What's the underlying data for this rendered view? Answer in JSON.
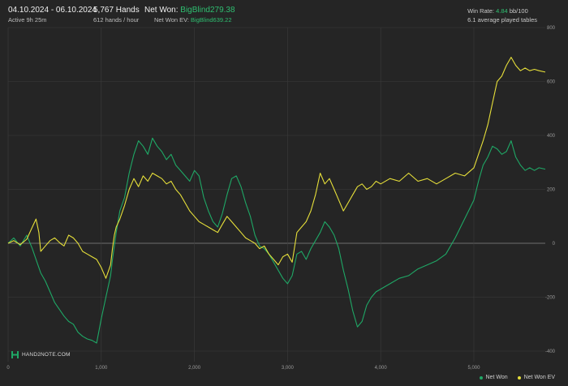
{
  "header": {
    "date_range": "04.10.2024 - 06.10.2024",
    "active": "Active 9h 25m",
    "hands": "5,767 Hands",
    "hands_rate": "612 hands / hour",
    "net_won_label": "Net Won:",
    "net_won_value": "BigBlind279.38",
    "net_won_ev_label": "Net Won  EV:",
    "net_won_ev_value": "BigBlind639.22",
    "win_rate_label": "Win Rate:",
    "win_rate_value": "4.84",
    "win_rate_unit": "bb/100",
    "avg_tables": "6.1 average played tables"
  },
  "logo": {
    "text": "HAND2NOTE.COM"
  },
  "legend": {
    "net_won": "Net Won",
    "net_won_ev": "Net Won  EV"
  },
  "colors": {
    "background": "#252525",
    "grid": "#3c3c3c",
    "zero_line": "#8a8a8a",
    "net_won": "#1fa866",
    "net_won_ev": "#e6df3a",
    "accent": "#2fbf71"
  },
  "chart_data": {
    "type": "line",
    "xlim": [
      0,
      5767
    ],
    "ylim": [
      -400,
      800
    ],
    "x_ticks": [
      0,
      1000,
      2000,
      3000,
      4000,
      5000
    ],
    "x_tick_labels": [
      "0",
      "1,000",
      "2,000",
      "3,000",
      "4,000",
      "5,000"
    ],
    "y_ticks": [
      -400,
      -200,
      0,
      200,
      400,
      600,
      800
    ],
    "y_tick_labels": [
      "-400",
      "-200",
      "0",
      "200",
      "400",
      "600",
      "800"
    ],
    "series": [
      {
        "name": "Net Won",
        "color": "#1fa866",
        "x": [
          0,
          60,
          130,
          200,
          260,
          300,
          330,
          350,
          400,
          450,
          500,
          560,
          600,
          650,
          700,
          750,
          800,
          850,
          900,
          950,
          1000,
          1050,
          1100,
          1120,
          1140,
          1160,
          1200,
          1250,
          1300,
          1350,
          1400,
          1450,
          1500,
          1550,
          1600,
          1650,
          1700,
          1750,
          1800,
          1850,
          1900,
          1950,
          2000,
          2050,
          2100,
          2150,
          2200,
          2250,
          2300,
          2350,
          2400,
          2450,
          2500,
          2550,
          2600,
          2650,
          2700,
          2750,
          2800,
          2850,
          2900,
          2950,
          3000,
          3050,
          3100,
          3150,
          3200,
          3250,
          3300,
          3350,
          3400,
          3450,
          3500,
          3550,
          3600,
          3650,
          3700,
          3750,
          3800,
          3850,
          3900,
          3950,
          4000,
          4100,
          4200,
          4300,
          4400,
          4500,
          4600,
          4700,
          4800,
          4900,
          5000,
          5050,
          5100,
          5150,
          5200,
          5250,
          5300,
          5350,
          5400,
          5450,
          5500,
          5550,
          5600,
          5650,
          5700,
          5767
        ],
        "values": [
          0,
          20,
          -10,
          30,
          -20,
          -60,
          -90,
          -110,
          -140,
          -180,
          -220,
          -250,
          -270,
          -290,
          -300,
          -330,
          -345,
          -355,
          -360,
          -370,
          -280,
          -200,
          -120,
          -60,
          -10,
          40,
          120,
          170,
          260,
          330,
          380,
          360,
          330,
          390,
          360,
          340,
          310,
          330,
          290,
          270,
          250,
          230,
          270,
          250,
          170,
          120,
          80,
          60,
          110,
          180,
          240,
          250,
          210,
          150,
          100,
          30,
          -10,
          -20,
          -40,
          -70,
          -100,
          -130,
          -150,
          -120,
          -40,
          -30,
          -60,
          -20,
          10,
          40,
          80,
          60,
          30,
          -20,
          -100,
          -170,
          -250,
          -310,
          -290,
          -230,
          -200,
          -180,
          -170,
          -150,
          -130,
          -120,
          -95,
          -80,
          -65,
          -40,
          20,
          90,
          160,
          230,
          290,
          320,
          360,
          350,
          330,
          340,
          380,
          320,
          290,
          270,
          280,
          270,
          280,
          275
        ]
      },
      {
        "name": "Net Won  EV",
        "color": "#e6df3a",
        "x": [
          0,
          60,
          130,
          200,
          260,
          300,
          330,
          350,
          400,
          450,
          500,
          560,
          600,
          650,
          700,
          750,
          800,
          850,
          900,
          950,
          1000,
          1050,
          1100,
          1120,
          1140,
          1160,
          1200,
          1250,
          1300,
          1350,
          1400,
          1450,
          1500,
          1550,
          1600,
          1650,
          1700,
          1750,
          1800,
          1850,
          1900,
          1950,
          2000,
          2050,
          2100,
          2150,
          2200,
          2250,
          2300,
          2350,
          2400,
          2450,
          2500,
          2550,
          2600,
          2650,
          2700,
          2750,
          2800,
          2850,
          2900,
          2950,
          3000,
          3050,
          3100,
          3150,
          3200,
          3250,
          3300,
          3350,
          3400,
          3450,
          3500,
          3550,
          3600,
          3650,
          3700,
          3750,
          3800,
          3850,
          3900,
          3950,
          4000,
          4100,
          4200,
          4300,
          4400,
          4500,
          4600,
          4700,
          4800,
          4900,
          5000,
          5050,
          5100,
          5150,
          5200,
          5250,
          5300,
          5350,
          5400,
          5450,
          5500,
          5550,
          5600,
          5650,
          5700,
          5767
        ],
        "values": [
          0,
          10,
          -5,
          15,
          60,
          90,
          40,
          -30,
          -10,
          10,
          20,
          0,
          -10,
          30,
          20,
          0,
          -30,
          -40,
          -50,
          -60,
          -90,
          -130,
          -80,
          -20,
          30,
          60,
          90,
          140,
          200,
          240,
          210,
          250,
          230,
          260,
          250,
          240,
          220,
          230,
          200,
          180,
          150,
          120,
          100,
          80,
          70,
          60,
          50,
          40,
          70,
          100,
          80,
          60,
          40,
          20,
          10,
          0,
          -20,
          -10,
          -40,
          -60,
          -80,
          -50,
          -40,
          -70,
          40,
          60,
          80,
          120,
          180,
          260,
          220,
          240,
          200,
          160,
          120,
          150,
          180,
          210,
          220,
          200,
          210,
          230,
          220,
          240,
          230,
          260,
          230,
          240,
          220,
          240,
          260,
          250,
          280,
          330,
          380,
          440,
          520,
          600,
          620,
          660,
          690,
          660,
          640,
          650,
          640,
          645,
          640,
          635
        ]
      }
    ]
  }
}
